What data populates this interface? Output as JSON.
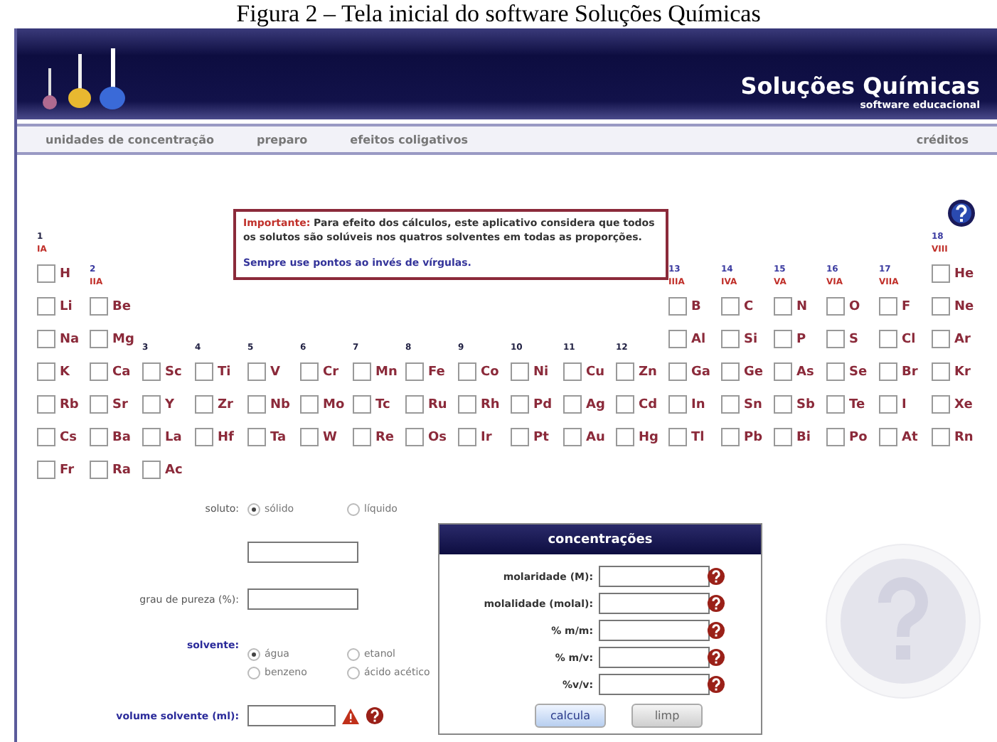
{
  "caption": "Figura 2 – Tela inicial do software Soluções Químicas",
  "header": {
    "title": "Soluções Químicas",
    "subtitle": "software educacional"
  },
  "nav": {
    "items": [
      {
        "label": "unidades de concentração"
      },
      {
        "label": "preparo"
      },
      {
        "label": "efeitos coligativos"
      }
    ],
    "right": {
      "label": "créditos"
    }
  },
  "notice": {
    "lead": "Importante:",
    "text": "Para efeito dos cálculos, este aplicativo considera que todos os solutos são solúveis nos quatros solventes em todas as proporções.",
    "hint": "Sempre use pontos ao invés de vírgulas."
  },
  "groups": [
    {
      "number": "1",
      "roman": "IA"
    },
    {
      "number": "2",
      "roman": "IIA"
    },
    {
      "number": "3"
    },
    {
      "number": "4"
    },
    {
      "number": "5"
    },
    {
      "number": "6"
    },
    {
      "number": "7"
    },
    {
      "number": "8"
    },
    {
      "number": "9"
    },
    {
      "number": "10"
    },
    {
      "number": "11"
    },
    {
      "number": "12"
    },
    {
      "number": "13",
      "roman": "IIIA"
    },
    {
      "number": "14",
      "roman": "IVA"
    },
    {
      "number": "15",
      "roman": "VA"
    },
    {
      "number": "16",
      "roman": "VIA"
    },
    {
      "number": "17",
      "roman": "VIIA"
    },
    {
      "number": "18",
      "roman": "VIII"
    }
  ],
  "periods": [
    {
      "elements": [
        {
          "symbol": "H",
          "checked": false
        },
        {
          "symbol": "He",
          "checked": false
        }
      ]
    },
    {
      "elements": [
        {
          "symbol": "Li",
          "checked": false
        },
        {
          "symbol": "Be",
          "checked": false
        },
        {
          "symbol": "B",
          "checked": false
        },
        {
          "symbol": "C",
          "checked": false
        },
        {
          "symbol": "N",
          "checked": false
        },
        {
          "symbol": "O",
          "checked": false
        },
        {
          "symbol": "F",
          "checked": false
        },
        {
          "symbol": "Ne",
          "checked": false
        }
      ]
    },
    {
      "elements": [
        {
          "symbol": "Na",
          "checked": false
        },
        {
          "symbol": "Mg",
          "checked": false
        },
        {
          "symbol": "Al",
          "checked": false
        },
        {
          "symbol": "Si",
          "checked": false
        },
        {
          "symbol": "P",
          "checked": false
        },
        {
          "symbol": "S",
          "checked": false
        },
        {
          "symbol": "Cl",
          "checked": false
        },
        {
          "symbol": "Ar",
          "checked": false
        }
      ]
    },
    {
      "elements": [
        {
          "symbol": "K",
          "checked": false
        },
        {
          "symbol": "Ca",
          "checked": false
        },
        {
          "symbol": "Sc",
          "checked": false
        },
        {
          "symbol": "Ti",
          "checked": false
        },
        {
          "symbol": "V",
          "checked": false
        },
        {
          "symbol": "Cr",
          "checked": false
        },
        {
          "symbol": "Mn",
          "checked": false
        },
        {
          "symbol": "Fe",
          "checked": false
        },
        {
          "symbol": "Co",
          "checked": false
        },
        {
          "symbol": "Ni",
          "checked": false
        },
        {
          "symbol": "Cu",
          "checked": false
        },
        {
          "symbol": "Zn",
          "checked": false
        },
        {
          "symbol": "Ga",
          "checked": false
        },
        {
          "symbol": "Ge",
          "checked": false
        },
        {
          "symbol": "As",
          "checked": false
        },
        {
          "symbol": "Se",
          "checked": false
        },
        {
          "symbol": "Br",
          "checked": false
        },
        {
          "symbol": "Kr",
          "checked": false
        }
      ]
    },
    {
      "elements": [
        {
          "symbol": "Rb",
          "checked": false
        },
        {
          "symbol": "Sr",
          "checked": false
        },
        {
          "symbol": "Y",
          "checked": false
        },
        {
          "symbol": "Zr",
          "checked": false
        },
        {
          "symbol": "Nb",
          "checked": false
        },
        {
          "symbol": "Mo",
          "checked": false
        },
        {
          "symbol": "Tc",
          "checked": false
        },
        {
          "symbol": "Ru",
          "checked": false
        },
        {
          "symbol": "Rh",
          "checked": false
        },
        {
          "symbol": "Pd",
          "checked": false
        },
        {
          "symbol": "Ag",
          "checked": false
        },
        {
          "symbol": "Cd",
          "checked": false
        },
        {
          "symbol": "In",
          "checked": false
        },
        {
          "symbol": "Sn",
          "checked": false
        },
        {
          "symbol": "Sb",
          "checked": false
        },
        {
          "symbol": "Te",
          "checked": false
        },
        {
          "symbol": "I",
          "checked": false
        },
        {
          "symbol": "Xe",
          "checked": false
        }
      ]
    },
    {
      "elements": [
        {
          "symbol": "Cs",
          "checked": false
        },
        {
          "symbol": "Ba",
          "checked": false
        },
        {
          "symbol": "La",
          "checked": false
        },
        {
          "symbol": "Hf",
          "checked": false
        },
        {
          "symbol": "Ta",
          "checked": false
        },
        {
          "symbol": "W",
          "checked": false
        },
        {
          "symbol": "Re",
          "checked": false
        },
        {
          "symbol": "Os",
          "checked": false
        },
        {
          "symbol": "Ir",
          "checked": false
        },
        {
          "symbol": "Pt",
          "checked": false
        },
        {
          "symbol": "Au",
          "checked": false
        },
        {
          "symbol": "Hg",
          "checked": false
        },
        {
          "symbol": "Tl",
          "checked": false
        },
        {
          "symbol": "Pb",
          "checked": false
        },
        {
          "symbol": "Bi",
          "checked": false
        },
        {
          "symbol": "Po",
          "checked": false
        },
        {
          "symbol": "At",
          "checked": false
        },
        {
          "symbol": "Rn",
          "checked": false
        }
      ]
    },
    {
      "elements": [
        {
          "symbol": "Fr",
          "checked": false
        },
        {
          "symbol": "Ra",
          "checked": false
        },
        {
          "symbol": "Ac",
          "checked": false
        }
      ]
    }
  ],
  "solute": {
    "label": "soluto:",
    "options": [
      {
        "label": "sólido",
        "selected": true
      },
      {
        "label": "líquido",
        "selected": false
      }
    ]
  },
  "purity": {
    "label": "grau de pureza (%):"
  },
  "solvent": {
    "label": "solvente:",
    "options": [
      {
        "label": "água",
        "selected": true
      },
      {
        "label": "etanol",
        "selected": false
      },
      {
        "label": "benzeno",
        "selected": false
      },
      {
        "label": "ácido acético",
        "selected": false
      }
    ]
  },
  "volume": {
    "label": "volume solvente (ml):"
  },
  "concentrations": {
    "title": "concentrações",
    "fields": [
      {
        "label": "molaridade (M):"
      },
      {
        "label": "molalidade (molal):"
      },
      {
        "label": "% m/m:"
      },
      {
        "label": "% m/v:"
      },
      {
        "label": "%v/v:"
      }
    ],
    "buttons": [
      {
        "label": "calcula",
        "kind": "primary"
      },
      {
        "label": "limp",
        "kind": "secondary"
      }
    ]
  }
}
